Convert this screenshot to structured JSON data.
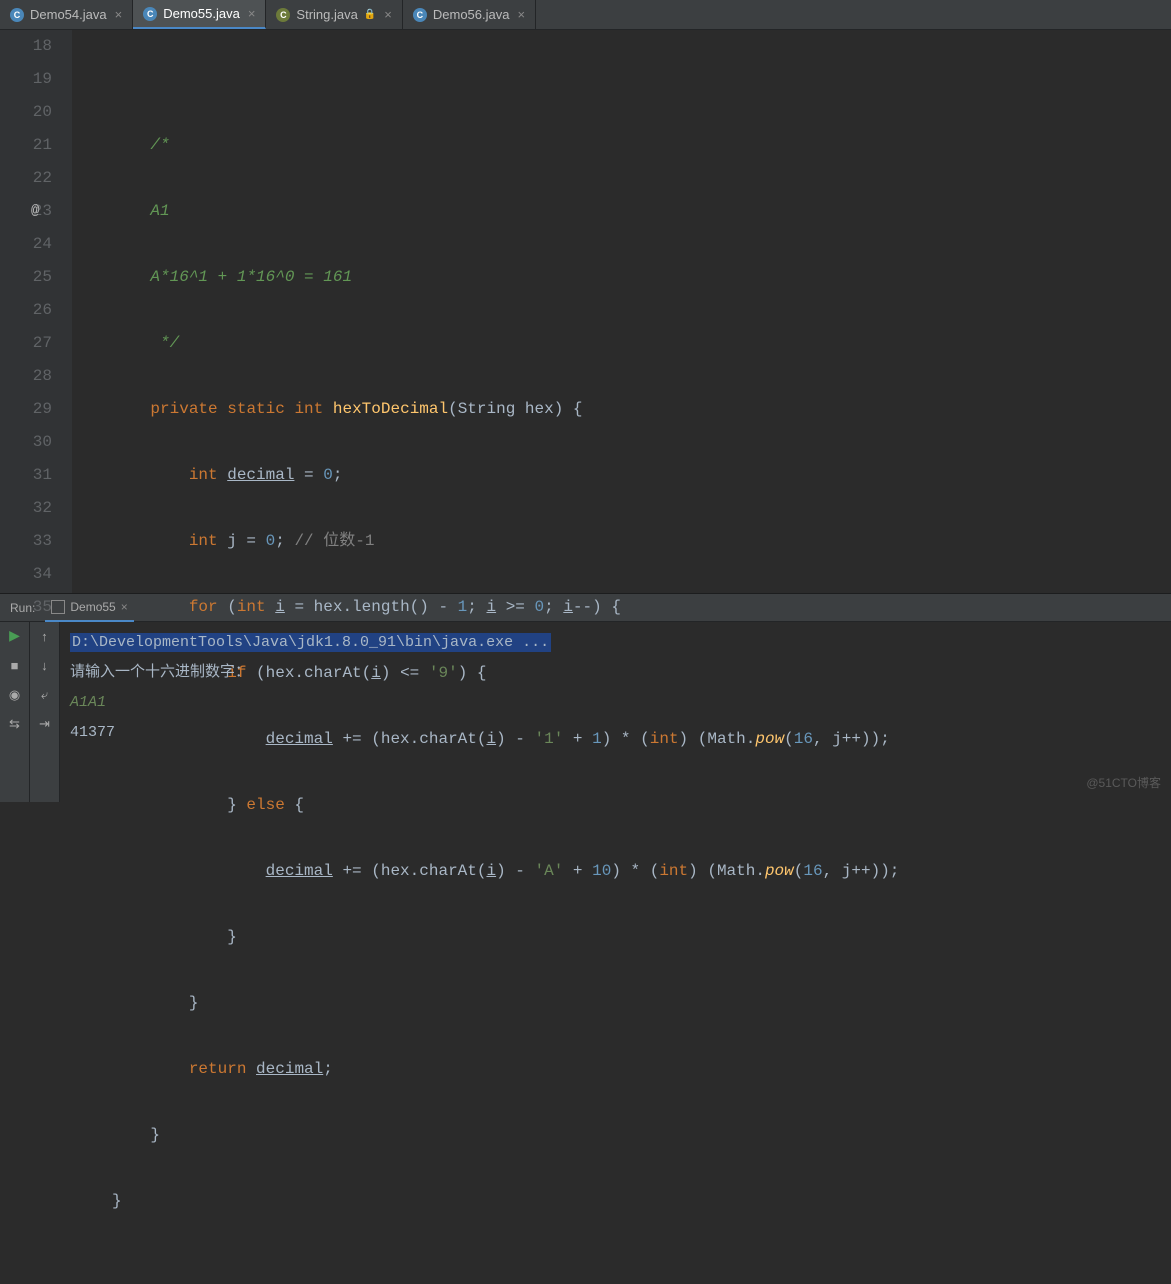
{
  "tabs": [
    {
      "label": "Demo54.java",
      "active": false,
      "modified": false
    },
    {
      "label": "Demo55.java",
      "active": true,
      "modified": true
    },
    {
      "label": "String.java",
      "active": false,
      "modified": false,
      "lib": true,
      "lock": true
    },
    {
      "label": "Demo56.java",
      "active": false,
      "modified": false
    }
  ],
  "gutter": {
    "lines": [
      "18",
      "19",
      "20",
      "21",
      "22",
      "23",
      "24",
      "25",
      "26",
      "27",
      "28",
      "29",
      "30",
      "31",
      "32",
      "33",
      "34",
      "35"
    ],
    "override_at": "23",
    "override_char": "@"
  },
  "code": {
    "l19": "/*",
    "l20": "A1",
    "l21": "A*16^1 + 1*16^0 = 161",
    "l22": " */",
    "k_private": "private",
    "k_static": "static",
    "k_int": "int",
    "fn": "hexToDecimal",
    "p1": "(String hex) {",
    "l24a": "int ",
    "l24b": "decimal",
    "l24c": " = ",
    "l24d": "0",
    "l24e": ";",
    "l25a": "int ",
    "l25b": "j = ",
    "l25c": "0",
    "l25d": "; ",
    "l25e": "// 位数-1",
    "k_for": "for",
    "l26a": " (",
    "l26b": "int ",
    "l26c": "i",
    "l26d": " = hex.length() - ",
    "l26e": "1",
    "l26f": "; ",
    "l26g": "i",
    "l26h": " >= ",
    "l26i": "0",
    "l26j": "; ",
    "l26k": "i",
    "l26l": "--) {",
    "k_if": "if",
    "l27a": " (hex.charAt(",
    "l27b": "i",
    "l27c": ") <= ",
    "l27d": "'9'",
    "l27e": ") {",
    "l28a": "decimal",
    "l28b": " += (hex.charAt(",
    "l28c": "i",
    "l28d": ") - ",
    "l28e": "'1'",
    "l28f": " + ",
    "l28g": "1",
    "l28h": ") * (",
    "l28i": "int",
    "l28j": ") (Math.",
    "l28k": "pow",
    "l28l": "(",
    "l28m": "16",
    "l28n": ", j++));",
    "k_else": "} else {",
    "l30a": "decimal",
    "l30b": " += (hex.charAt(",
    "l30c": "i",
    "l30d": ") - ",
    "l30e": "'A'",
    "l30f": " + ",
    "l30g": "10",
    "l30h": ") * (",
    "l30i": "int",
    "l30j": ") (Math.",
    "l30k": "pow",
    "l30l": "(",
    "l30m": "16",
    "l30n": ", j++));",
    "l31": "}",
    "l32": "}",
    "k_return": "return",
    "l33a": " ",
    "l33b": "decimal",
    "l33c": ";",
    "l34": "}",
    "l35": "}"
  },
  "run": {
    "label": "Run:",
    "tab": "Demo55",
    "cmd": "D:\\DevelopmentTools\\Java\\jdk1.8.0_91\\bin\\java.exe ...",
    "prompt": "请输入一个十六进制数字：",
    "input": "A1A1",
    "output": "41377"
  },
  "watermark": "@51CTO博客"
}
